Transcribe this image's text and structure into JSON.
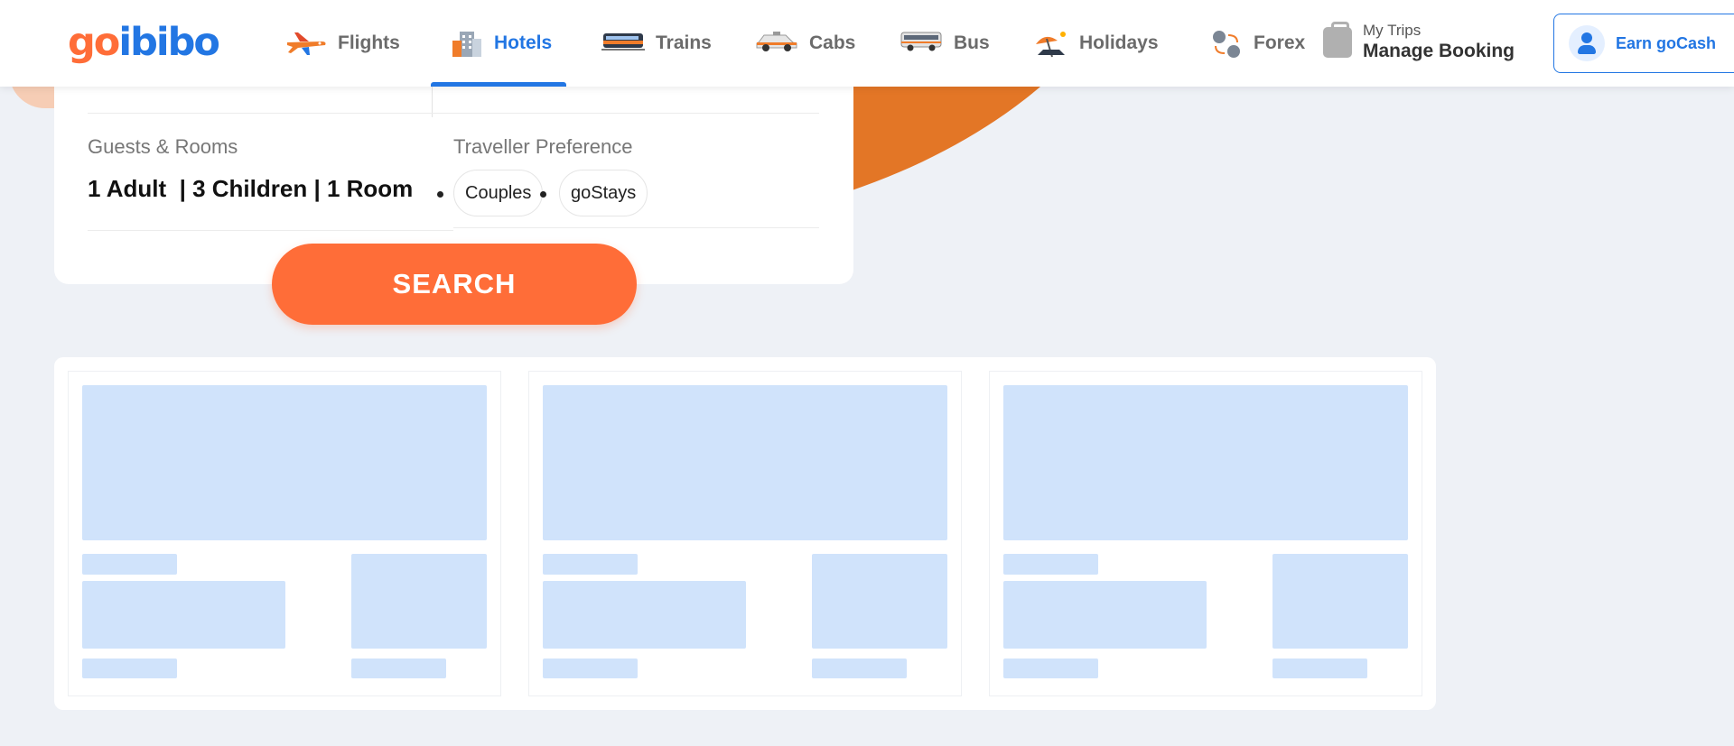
{
  "logo": {
    "part1": "go",
    "part2": "ibibo"
  },
  "nav": [
    {
      "label": "Flights",
      "icon": "plane-icon"
    },
    {
      "label": "Hotels",
      "icon": "hotel-icon",
      "active": true
    },
    {
      "label": "Trains",
      "icon": "train-icon"
    },
    {
      "label": "Cabs",
      "icon": "cab-icon"
    },
    {
      "label": "Bus",
      "icon": "bus-icon"
    },
    {
      "label": "Holidays",
      "icon": "beach-umbrella-icon"
    },
    {
      "label": "Forex",
      "icon": "currency-exchange-icon"
    }
  ],
  "my_trips": {
    "title": "My Trips",
    "subtitle": "Manage Booking"
  },
  "earn_button": {
    "label": "Earn goCash"
  },
  "search": {
    "guests_label": "Guests & Rooms",
    "guests_value": "1 Adult  | 3 Children | 1 Room",
    "preference_label": "Traveller Preference",
    "preferences": [
      "Couples",
      "goStays"
    ],
    "button_label": "SEARCH"
  },
  "colors": {
    "brand_orange": "#ff6d38",
    "brand_blue": "#2276e3",
    "skeleton": "#d0e3fb",
    "page_bg": "#eef1f6"
  }
}
